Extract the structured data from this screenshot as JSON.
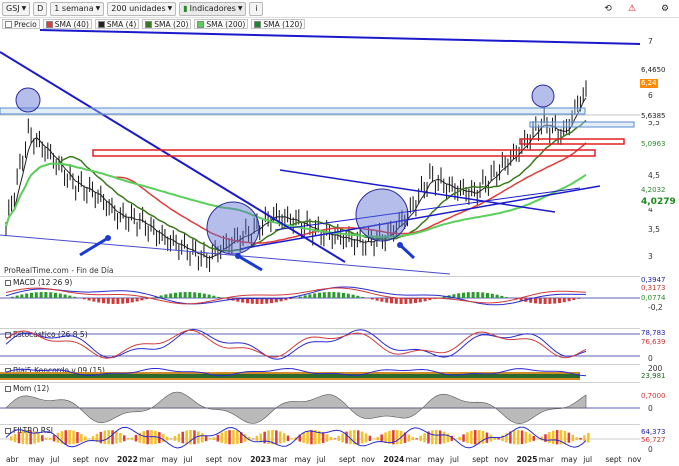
{
  "toolbar": {
    "symbol": "GSJ",
    "period_short": "D",
    "interval": "1 semana",
    "units": "200 unidades",
    "indicators_label": "Indicadores",
    "info_label": "i"
  },
  "legend": [
    {
      "label": "Precio",
      "color": "#ffffff"
    },
    {
      "label": "SMA (40)",
      "color": "#e03a3a"
    },
    {
      "label": "SMA (4)",
      "color": "#222222"
    },
    {
      "label": "SMA (20)",
      "color": "#3a7a1e"
    },
    {
      "label": "SMA (200)",
      "color": "#5ad05a"
    },
    {
      "label": "SMA (120)",
      "color": "#1a8a2a"
    }
  ],
  "watermark": "ProRealTime.com - Fin de Día",
  "price_axis": {
    "ticks": [
      "7",
      "6",
      "5,5",
      "4,5",
      "4",
      "3,5",
      "3"
    ],
    "tags": [
      {
        "text": "6,4650",
        "color": "#ffffff",
        "text_color": "#222222"
      },
      {
        "text": "6,24",
        "color": "#ff8c00",
        "text_color": "#ffffff"
      },
      {
        "text": "5,6385",
        "color": "#ffffff",
        "text_color": "#222222"
      },
      {
        "text": "5,0963",
        "color": "#ffffff",
        "text_color": "#2a8a2a"
      },
      {
        "text": "4,2032",
        "color": "#ffffff",
        "text_color": "#2a8a2a"
      },
      {
        "text": "4,0279",
        "color": "#ffffff",
        "text_color": "#1a8a1a"
      }
    ]
  },
  "panes": {
    "macd": {
      "label": "MACD (12 26 9)",
      "tags": [
        "0,3947",
        "0,3173",
        "0,0774"
      ],
      "ticks": [
        "-0,2"
      ]
    },
    "stoch": {
      "label": "Estocástico (26 8 5)",
      "tags": [
        "78,783",
        "76,639"
      ],
      "ticks": [
        "0"
      ]
    },
    "koncorde": {
      "label": "Blai5 Koncorde v.09 (15)",
      "tags": [
        "200",
        "23,981"
      ],
      "ticks": [
        "0"
      ]
    },
    "mom": {
      "label": "Mom (12)",
      "tags": [
        "0,7000"
      ],
      "ticks": [
        "0"
      ]
    },
    "filtro": {
      "label": "FILTRO RSI",
      "tags": [
        "64,373",
        "56,727"
      ],
      "ticks": [
        "0"
      ]
    }
  },
  "x_axis": [
    {
      "label": "abr",
      "year": false
    },
    {
      "label": "may",
      "year": false
    },
    {
      "label": "jul",
      "year": false
    },
    {
      "label": "sept",
      "year": false
    },
    {
      "label": "nov",
      "year": false
    },
    {
      "label": "2022",
      "year": true
    },
    {
      "label": "mar",
      "year": false
    },
    {
      "label": "may",
      "year": false
    },
    {
      "label": "jul",
      "year": false
    },
    {
      "label": "sept",
      "year": false
    },
    {
      "label": "nov",
      "year": false
    },
    {
      "label": "2023",
      "year": true
    },
    {
      "label": "mar",
      "year": false
    },
    {
      "label": "may",
      "year": false
    },
    {
      "label": "jul",
      "year": false
    },
    {
      "label": "sept",
      "year": false
    },
    {
      "label": "nov",
      "year": false
    },
    {
      "label": "2024",
      "year": true
    },
    {
      "label": "mar",
      "year": false
    },
    {
      "label": "may",
      "year": false
    },
    {
      "label": "jul",
      "year": false
    },
    {
      "label": "sept",
      "year": false
    },
    {
      "label": "nov",
      "year": false
    },
    {
      "label": "2025",
      "year": true
    },
    {
      "label": "mar",
      "year": false
    },
    {
      "label": "may",
      "year": false
    },
    {
      "label": "jul",
      "year": false
    },
    {
      "label": "sept",
      "year": false
    },
    {
      "label": "nov",
      "year": false
    }
  ],
  "chart_data": {
    "type": "line",
    "title": "",
    "xlabel": "",
    "ylabel": "",
    "ylim": [
      2.9,
      7.1
    ],
    "x": [
      "2021-04",
      "2021-06",
      "2021-08",
      "2021-10",
      "2021-12",
      "2022-02",
      "2022-04",
      "2022-06",
      "2022-08",
      "2022-10",
      "2022-12",
      "2023-02",
      "2023-04",
      "2023-06",
      "2023-08",
      "2023-10",
      "2023-12",
      "2024-02",
      "2024-04",
      "2024-06",
      "2024-08",
      "2024-10",
      "2024-12",
      "2025-02",
      "2025-03",
      "2025-04",
      "2025-05"
    ],
    "series": [
      {
        "name": "Precio",
        "values": [
          3.7,
          5.4,
          5.0,
          4.5,
          4.3,
          3.9,
          3.8,
          3.5,
          3.3,
          3.1,
          3.4,
          3.6,
          3.9,
          3.8,
          3.6,
          3.5,
          3.4,
          3.5,
          3.9,
          4.6,
          4.4,
          4.3,
          4.7,
          5.1,
          5.6,
          5.4,
          6.24
        ]
      }
    ]
  }
}
